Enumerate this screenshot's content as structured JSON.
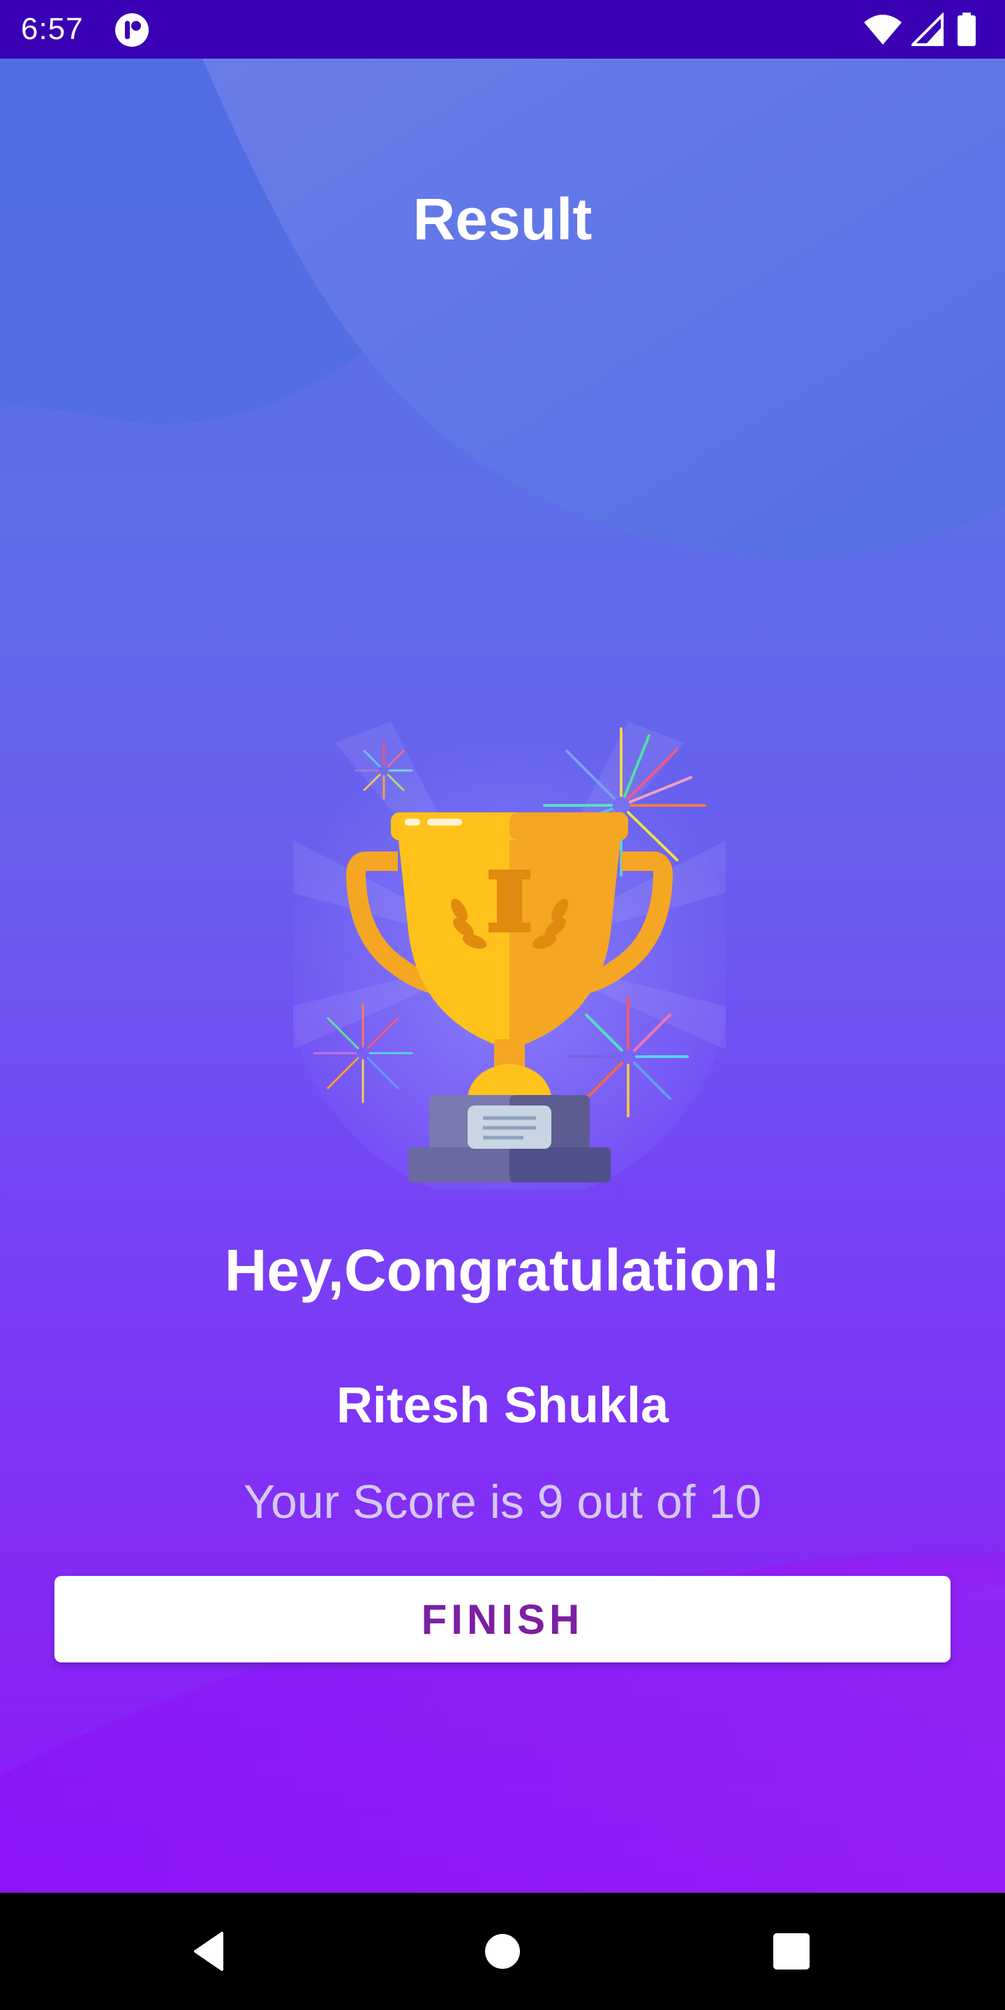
{
  "status_bar": {
    "time": "6:57",
    "icons": [
      "app-notification-icon",
      "wifi-icon",
      "cell-signal-icon",
      "battery-icon"
    ]
  },
  "header": {
    "title": "Result"
  },
  "result": {
    "illustration": "trophy-with-fireworks",
    "congrats_text": "Hey,Congratulation!",
    "user_name": "Ritesh Shukla",
    "score_text": "Your Score is 9 out of 10",
    "score": 9,
    "score_total": 10
  },
  "actions": {
    "finish_label": "FINISH"
  },
  "nav_bar": {
    "icons": [
      "back-icon",
      "home-icon",
      "recents-icon"
    ]
  },
  "colors": {
    "status_bar": "#3a00b4",
    "gradient_top": "#5a6fe6",
    "gradient_bottom": "#8f17f8",
    "finish_text": "#7b1fa2",
    "score_text": "#d4c9f0"
  }
}
